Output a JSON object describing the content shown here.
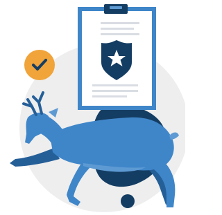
{
  "illustration": {
    "icons": [
      "check-badge-icon",
      "clipboard-icon",
      "police-badge-icon",
      "deer-icon"
    ],
    "colors": {
      "backdrop_circle": "#eeeeee",
      "navy": "#143d63",
      "deer_blue": "#3f86c9",
      "deer_light": "#5d9ad3",
      "deer_dark": "#255f98",
      "clipboard_frame": "#3f86c9",
      "clipboard_paper": "#ffffff",
      "text_lines": "#d9dde3",
      "check_badge": "#f0a43a",
      "check_mark": "#143d63"
    }
  }
}
